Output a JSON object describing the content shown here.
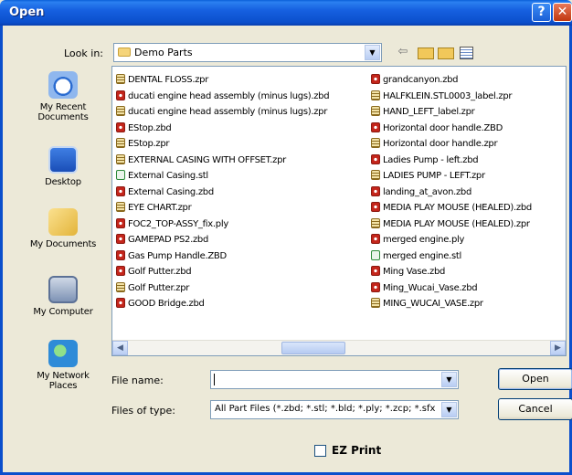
{
  "window": {
    "title": "Open",
    "help_glyph": "?",
    "close_glyph": "✕"
  },
  "look_in": {
    "label": "Look in:",
    "value": "Demo Parts",
    "arrow": "▼",
    "back_glyph": "⇦"
  },
  "places": [
    {
      "label": "My Recent Documents",
      "icon": "recent-documents-icon"
    },
    {
      "label": "Desktop",
      "icon": "desktop-icon"
    },
    {
      "label": "My Documents",
      "icon": "my-documents-icon"
    },
    {
      "label": "My Computer",
      "icon": "my-computer-icon"
    },
    {
      "label": "My Network Places",
      "icon": "network-places-icon"
    }
  ],
  "files": {
    "col1": [
      {
        "name": "DENTAL FLOSS.zpr",
        "type": "zpr"
      },
      {
        "name": "ducati engine head assembly (minus lugs).zbd",
        "type": "zbd"
      },
      {
        "name": "ducati engine head assembly (minus lugs).zpr",
        "type": "zpr"
      },
      {
        "name": "EStop.zbd",
        "type": "zbd"
      },
      {
        "name": "EStop.zpr",
        "type": "zpr"
      },
      {
        "name": "EXTERNAL CASING WITH OFFSET.zpr",
        "type": "zpr"
      },
      {
        "name": "External Casing.stl",
        "type": "stl"
      },
      {
        "name": "External Casing.zbd",
        "type": "zbd"
      },
      {
        "name": "EYE CHART.zpr",
        "type": "zpr"
      },
      {
        "name": "FOC2_TOP-ASSY_fix.ply",
        "type": "ply"
      },
      {
        "name": "GAMEPAD PS2.zbd",
        "type": "zbd"
      },
      {
        "name": "Gas Pump Handle.ZBD",
        "type": "zbd"
      },
      {
        "name": "Golf Putter.zbd",
        "type": "zbd"
      },
      {
        "name": "Golf Putter.zpr",
        "type": "zpr"
      },
      {
        "name": "GOOD Bridge.zbd",
        "type": "zbd"
      }
    ],
    "col2": [
      {
        "name": "grandcanyon.zbd",
        "type": "zbd"
      },
      {
        "name": "HALFKLEIN.STL0003_label.zpr",
        "type": "zpr"
      },
      {
        "name": "HAND_LEFT_label.zpr",
        "type": "zpr"
      },
      {
        "name": "Horizontal door handle.ZBD",
        "type": "zbd"
      },
      {
        "name": "Horizontal door handle.zpr",
        "type": "zpr"
      },
      {
        "name": "Ladies Pump - left.zbd",
        "type": "zbd"
      },
      {
        "name": "LADIES PUMP - LEFT.zpr",
        "type": "zpr"
      },
      {
        "name": "landing_at_avon.zbd",
        "type": "zbd"
      },
      {
        "name": "MEDIA PLAY MOUSE (HEALED).zbd",
        "type": "zbd"
      },
      {
        "name": "MEDIA PLAY MOUSE (HEALED).zpr",
        "type": "zpr"
      },
      {
        "name": "merged engine.ply",
        "type": "ply"
      },
      {
        "name": "merged engine.stl",
        "type": "stl"
      },
      {
        "name": "Ming Vase.zbd",
        "type": "zbd"
      },
      {
        "name": "Ming_Wucai_Vase.zbd",
        "type": "zbd"
      },
      {
        "name": "MING_WUCAI_VASE.zpr",
        "type": "zpr"
      }
    ]
  },
  "scroll": {
    "left_glyph": "◀",
    "right_glyph": "▶"
  },
  "file_name": {
    "label": "File name:",
    "value": "",
    "arrow": "▼"
  },
  "file_type": {
    "label": "Files of type:",
    "value": "All Part Files (*.zbd; *.stl; *.bld; *.ply; *.zcp; *.sfx",
    "arrow": "▼"
  },
  "buttons": {
    "open": "Open",
    "cancel": "Cancel"
  },
  "ez_print": {
    "label": "EZ Print",
    "checked": false
  }
}
